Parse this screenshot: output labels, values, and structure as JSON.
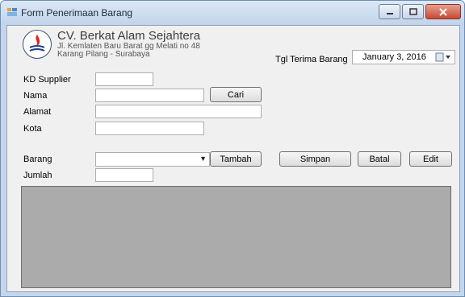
{
  "window": {
    "title": "Form Penerimaan Barang"
  },
  "company": {
    "name": "CV. Berkat Alam Sejahtera",
    "address_line1": "Jl. Kemlaten Baru Barat gg Melati no 48",
    "address_line2": "Karang Pilang - Surabaya"
  },
  "receipt_date": {
    "label": "Tgl Terima Barang",
    "value": "January    3, 2016"
  },
  "fields": {
    "kd_supplier": {
      "label": "KD Supplier",
      "value": ""
    },
    "nama": {
      "label": "Nama",
      "value": ""
    },
    "alamat": {
      "label": "Alamat",
      "value": ""
    },
    "kota": {
      "label": "Kota",
      "value": ""
    },
    "barang": {
      "label": "Barang",
      "value": ""
    },
    "jumlah": {
      "label": "Jumlah",
      "value": ""
    }
  },
  "buttons": {
    "cari": "Cari",
    "tambah": "Tambah",
    "simpan": "Simpan",
    "batal": "Batal",
    "edit": "Edit"
  },
  "colors": {
    "titlebar": "#c2d4ea",
    "client_bg": "#f0f0f0",
    "grid_bg": "#ababab",
    "close_button": "#c74a34"
  }
}
